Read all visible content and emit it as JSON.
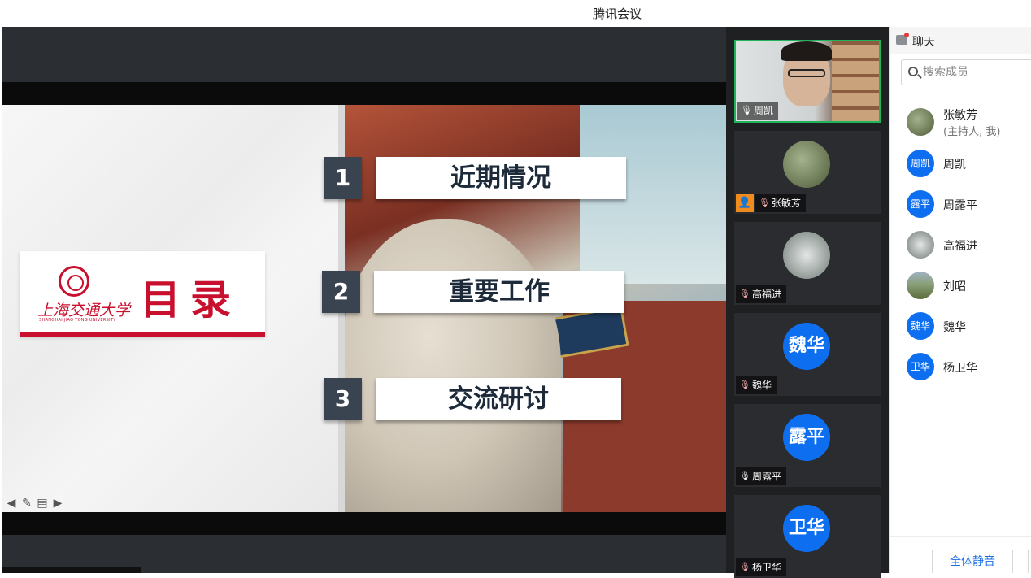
{
  "app": {
    "title": "腾讯会议"
  },
  "slide": {
    "logo_text_cn": "上海交通大学",
    "logo_text_en": "SHANGHAI JIAO TONG UNIVERSITY",
    "heading": "目录",
    "items": [
      {
        "num": "1",
        "label": "近期情况"
      },
      {
        "num": "2",
        "label": "重要工作"
      },
      {
        "num": "3",
        "label": "交流研讨"
      }
    ],
    "tools": [
      "arrow-left-icon",
      "pen-icon",
      "notes-icon",
      "arrow-right-icon"
    ]
  },
  "gallery": [
    {
      "name": "周凯",
      "kind": "video",
      "mic": "on",
      "active": true
    },
    {
      "name": "张敏芳",
      "kind": "photo-garden",
      "mic": "muted",
      "host": true
    },
    {
      "name": "高福进",
      "kind": "photo-falls",
      "mic": "muted"
    },
    {
      "name": "魏华",
      "kind": "initials",
      "initials": "魏华",
      "mic": "muted"
    },
    {
      "name": "周露平",
      "kind": "initials",
      "initials": "露平",
      "mic": "on"
    },
    {
      "name": "杨卫华",
      "kind": "initials",
      "initials": "卫华",
      "mic": "muted"
    }
  ],
  "panel": {
    "header": "聊天",
    "search_placeholder": "搜索成员",
    "members": [
      {
        "name": "张敏芳",
        "role": "(主持人, 我)",
        "avatar": "garden"
      },
      {
        "name": "周凯",
        "avatar": "blue",
        "initials": "周凯"
      },
      {
        "name": "周露平",
        "avatar": "blue",
        "initials": "露平"
      },
      {
        "name": "高福进",
        "avatar": "falls"
      },
      {
        "name": "刘昭",
        "avatar": "field"
      },
      {
        "name": "魏华",
        "avatar": "blue",
        "initials": "魏华"
      },
      {
        "name": "杨卫华",
        "avatar": "blue",
        "initials": "卫华"
      }
    ],
    "mute_all": "全体静音"
  },
  "colors": {
    "accent_blue": "#0e6ef0",
    "sjtu_red": "#c8102e",
    "active_green": "#1fb35a"
  }
}
